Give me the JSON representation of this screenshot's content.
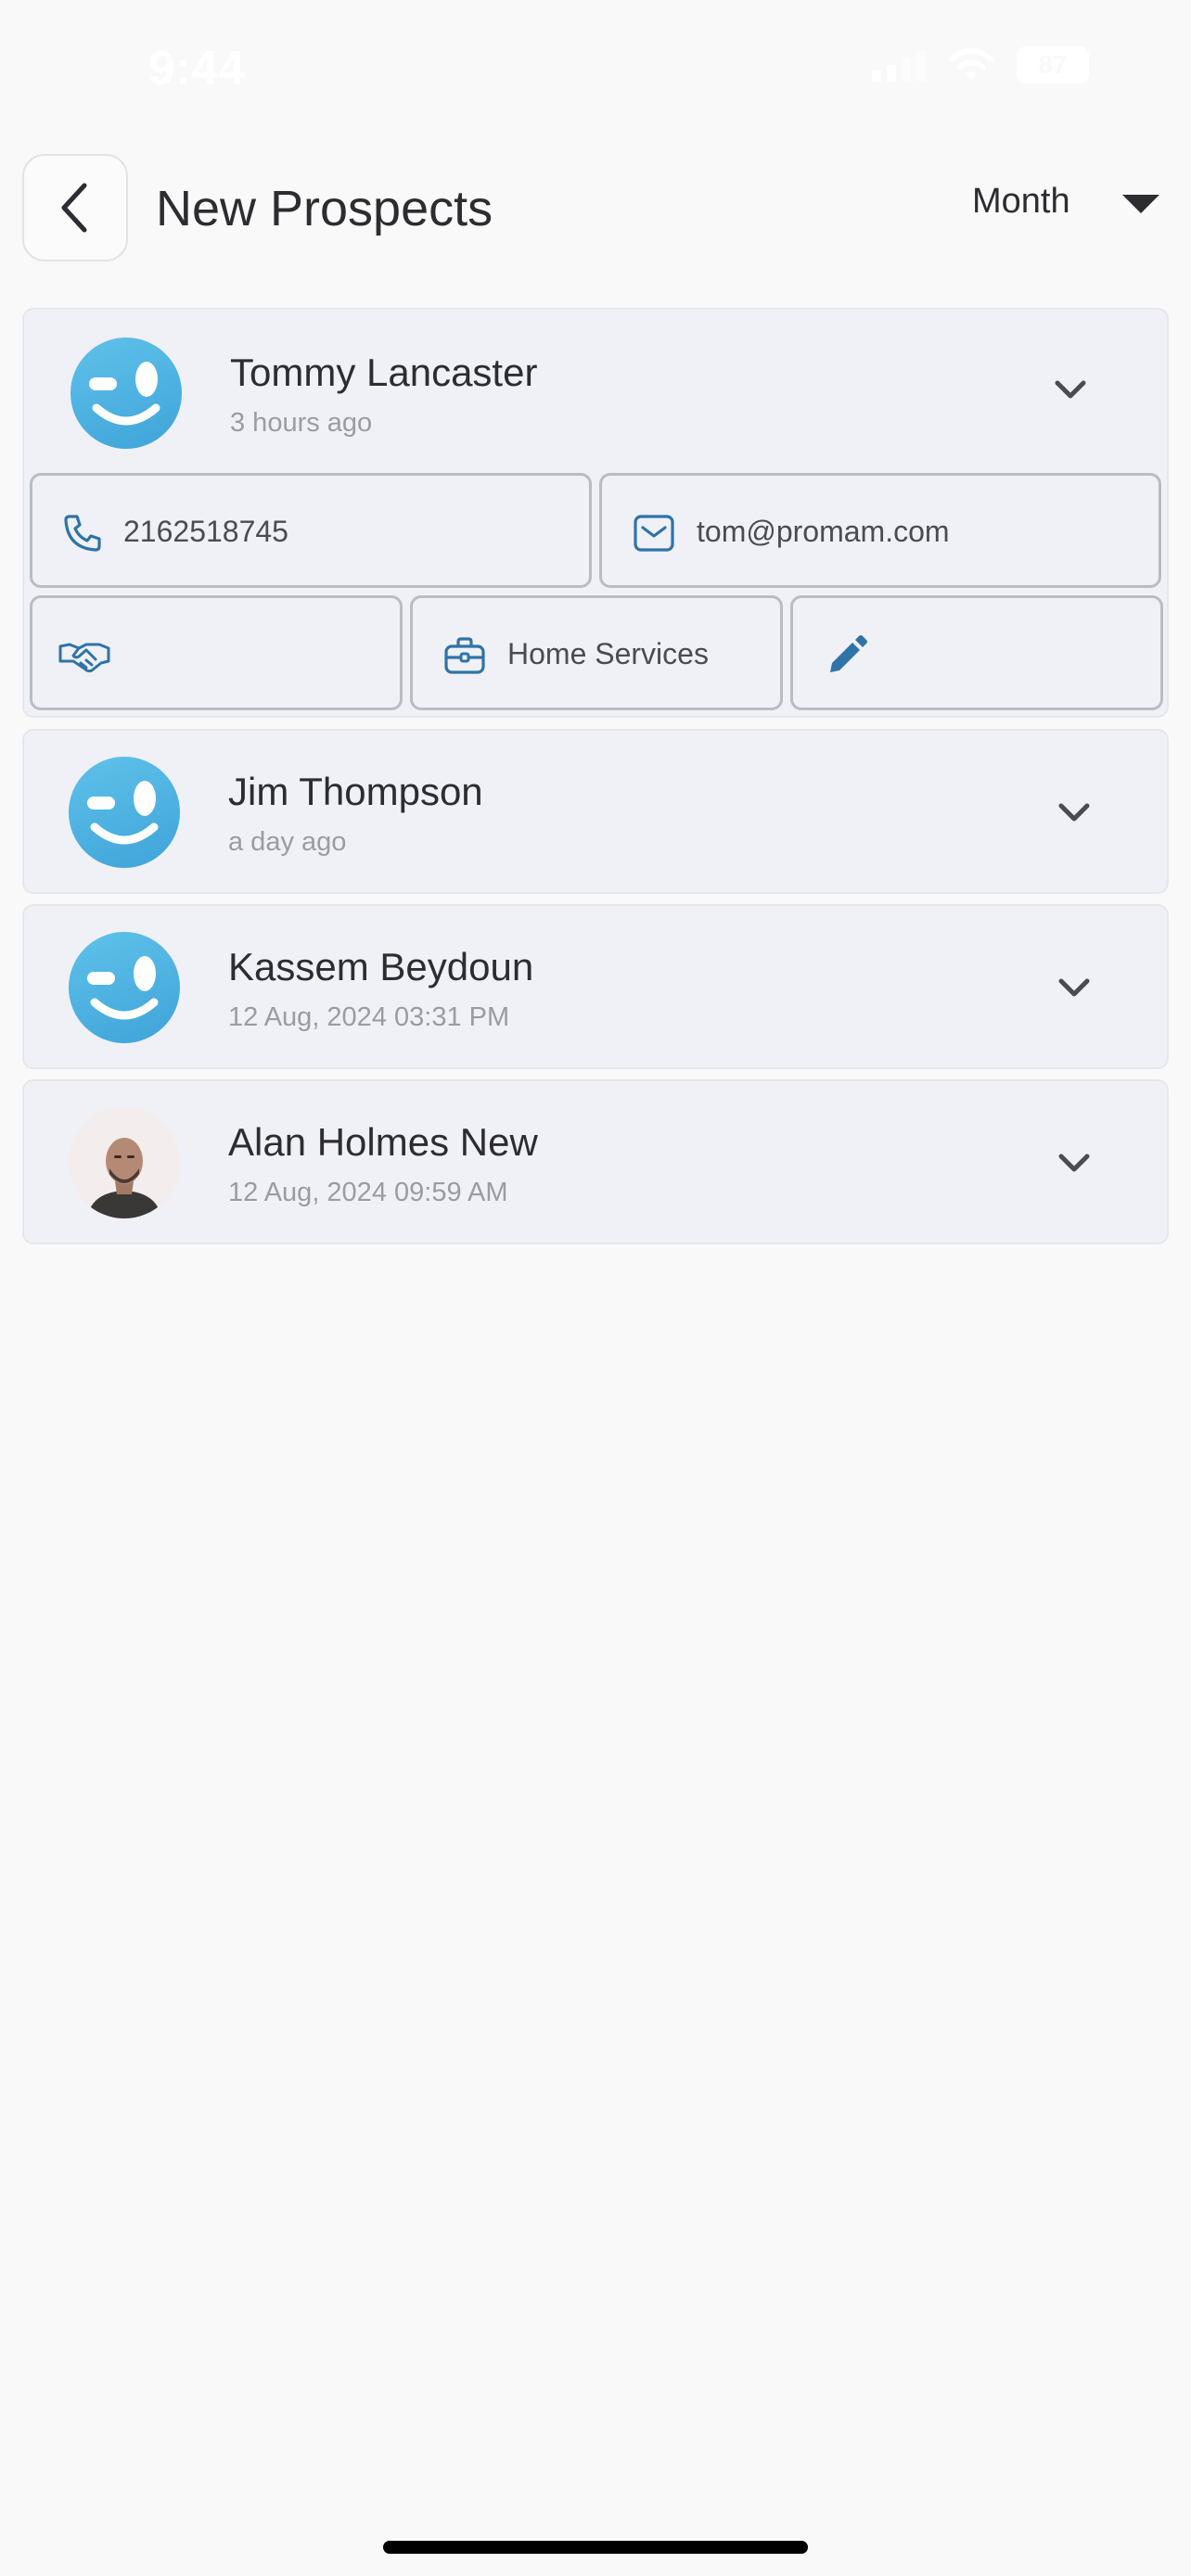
{
  "status_bar": {
    "time": "9:44",
    "battery": "87"
  },
  "header": {
    "title": "New Prospects",
    "filter": "Month"
  },
  "prospects": [
    {
      "name": "Tommy Lancaster",
      "time": "3 hours ago",
      "avatar": "smiley",
      "expanded": true,
      "phone": "2162518745",
      "email": "tom@promam.com",
      "industry": "Home Services",
      "deal": ""
    },
    {
      "name": "Jim Thompson",
      "time": "a day ago",
      "avatar": "smiley"
    },
    {
      "name": "Kassem Beydoun",
      "time": "12 Aug, 2024 03:31 PM",
      "avatar": "smiley"
    },
    {
      "name": "Alan Holmes New",
      "time": "12 Aug, 2024 09:59 AM",
      "avatar": "photo"
    }
  ],
  "colors": {
    "accent": "#2f73a8",
    "avatar_gradient_top": "#5fc2ea",
    "avatar_gradient_bottom": "#3fa3d9"
  }
}
